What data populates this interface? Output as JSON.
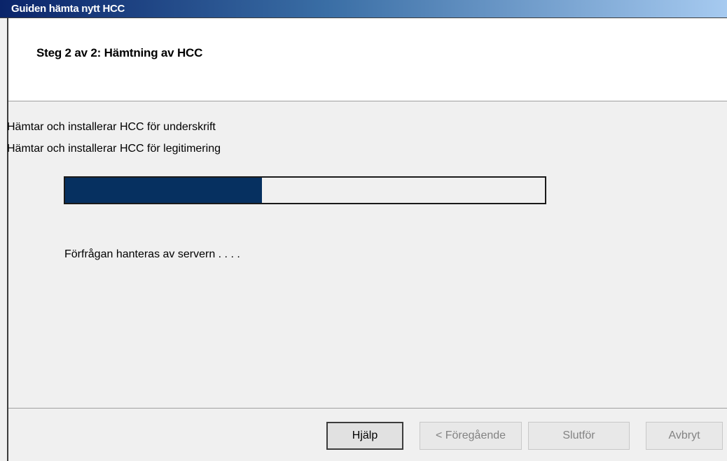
{
  "window": {
    "title": "Guiden hämta nytt HCC"
  },
  "header": {
    "step_title": "Steg 2 av 2: Hämtning av HCC"
  },
  "content": {
    "lines": [
      "Hämtar och installerar HCC för underskrift",
      "Hämtar och installerar HCC för legitimering"
    ],
    "progress_fraction": 0.41,
    "progress_color": "#063060",
    "status": "Förfrågan hanteras av servern . . . ."
  },
  "buttons": {
    "help": "Hjälp",
    "previous": "< Föregående",
    "finish": "Slutför",
    "cancel": "Avbryt"
  }
}
